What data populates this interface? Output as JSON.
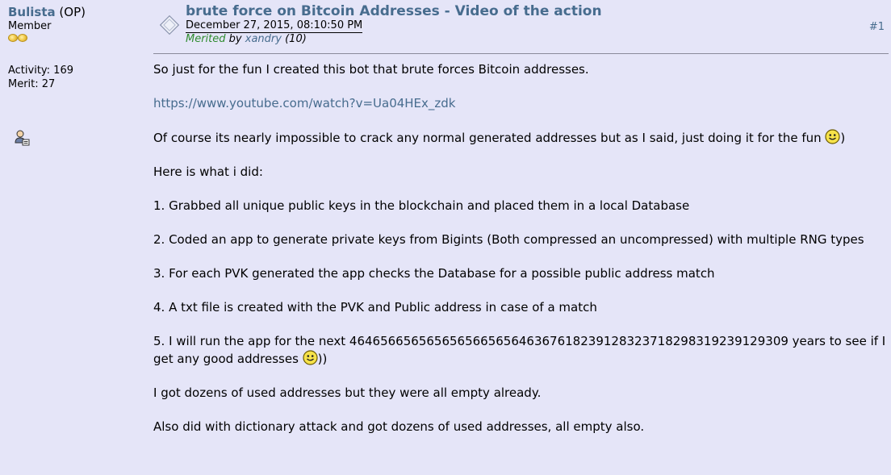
{
  "poster": {
    "name": "Bulista",
    "op_tag": "(OP)",
    "rank": "Member",
    "activity": "Activity: 169",
    "merit": "Merit: 27"
  },
  "post": {
    "title": "brute force on Bitcoin Addresses - Video of the action",
    "date": "December 27, 2015, 08:10:50 PM",
    "merited_label": "Merited",
    "merited_by": "by",
    "merit_user": "xandry",
    "merit_amount": "(10)",
    "number": "#1"
  },
  "body": {
    "p1": "So just for the fun I created this bot that brute forces Bitcoin addresses.",
    "link": "https://www.youtube.com/watch?v=Ua04HEx_zdk",
    "p3_text": "Of course its nearly impossible to crack any normal generated addresses but as I said, just doing it for the fun",
    "p3_tail": ")",
    "p4": "Here is what i did:",
    "p5": "1. Grabbed all unique public keys in the blockchain and placed them in a local Database",
    "p6": "2. Coded an app to generate private keys from Bigints (Both compressed an uncompressed) with multiple RNG types",
    "p7": "3. For each PVK generated the app checks the Database for a possible public address match",
    "p8": "4. A txt file is created with the PVK and Public address in case of a match",
    "p9_text": "5. I will run the app for the next 464656656565656566565646367618239128323718298319239129309 years to see if I get any good addresses",
    "p9_tail": "))",
    "p10": "I got dozens of used addresses but they were all empty already.",
    "p11": "Also did with dictionary attack and got dozens of used addresses, all empty also."
  },
  "icons": {
    "topic": "topic-icon",
    "profile": "profile-icon",
    "smiley": "smiley-icon",
    "coin": "coin-icon"
  },
  "colors": {
    "background": "#e5e5f8",
    "link": "#476c8e",
    "merited": "#2e8b2e"
  }
}
